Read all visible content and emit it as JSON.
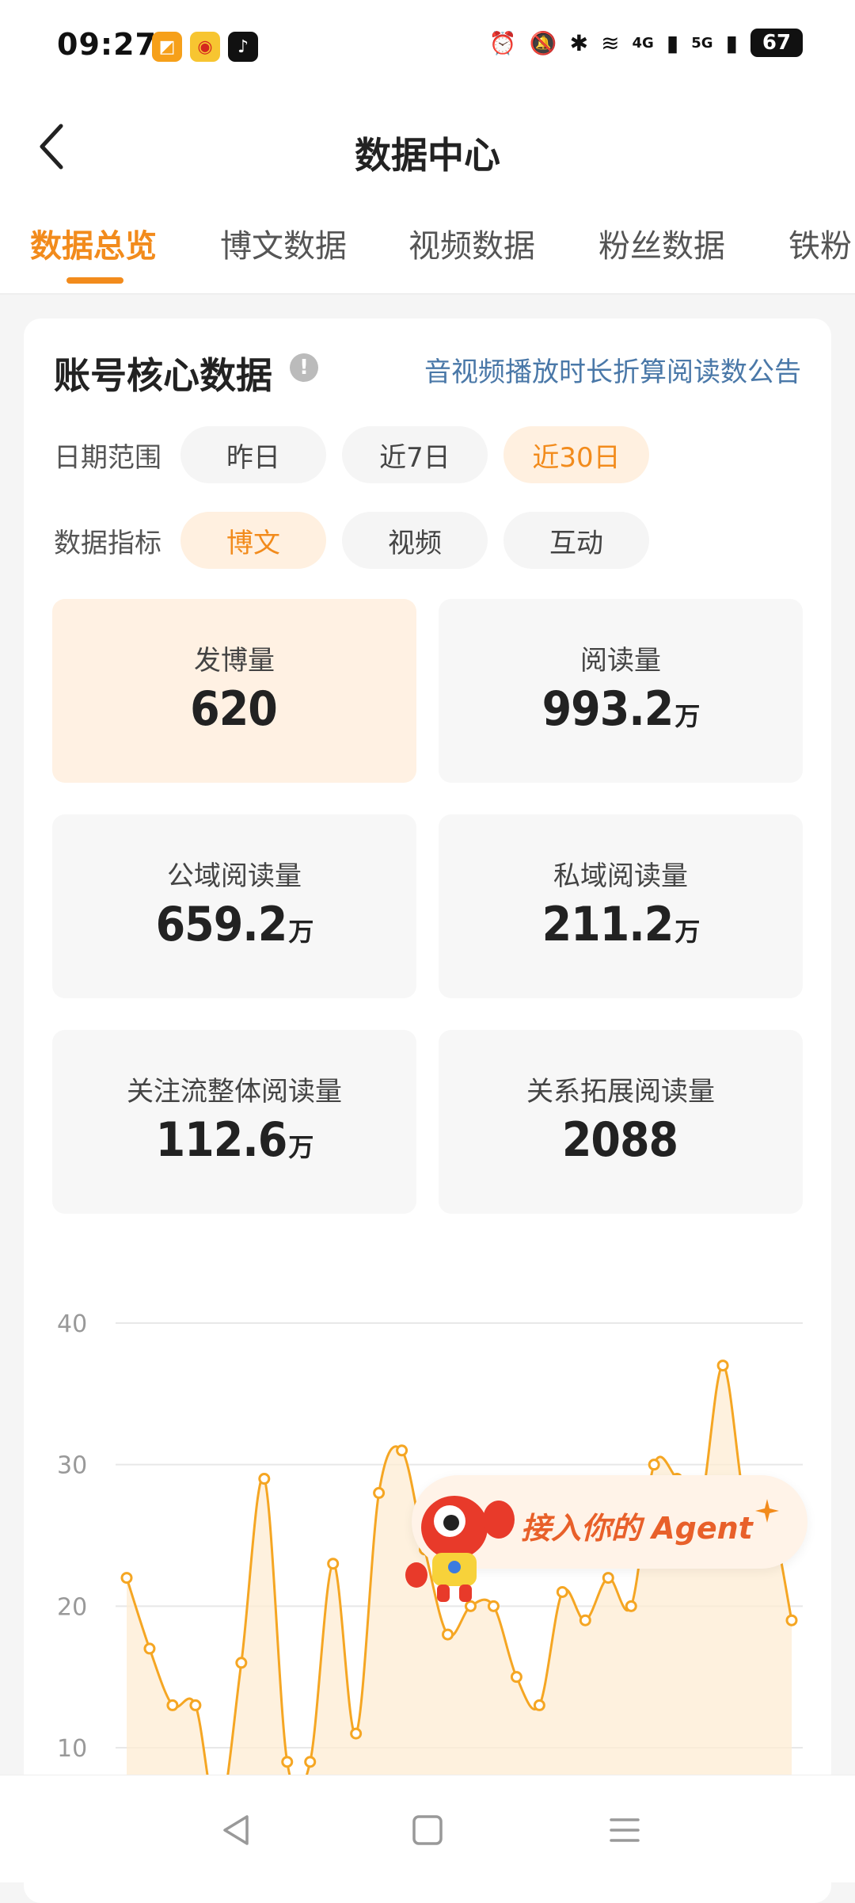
{
  "status": {
    "time": "09:27",
    "battery": "67",
    "signal_4g": "4G",
    "signal_5g": "5G"
  },
  "header": {
    "title": "数据中心"
  },
  "tabs": [
    "数据总览",
    "博文数据",
    "视频数据",
    "粉丝数据",
    "铁粉"
  ],
  "card": {
    "title": "账号核心数据",
    "notice": "音视频播放时长折算阅读数公告",
    "date_label": "日期范围",
    "date_options": [
      "昨日",
      "近7日",
      "近30日"
    ],
    "date_selected": "近30日",
    "metric_label": "数据指标",
    "metric_options": [
      "博文",
      "视频",
      "互动"
    ],
    "metric_selected": "博文"
  },
  "metrics": [
    {
      "label": "发博量",
      "value": "620",
      "unit": ""
    },
    {
      "label": "阅读量",
      "value": "993.2",
      "unit": "万"
    },
    {
      "label": "公域阅读量",
      "value": "659.2",
      "unit": "万"
    },
    {
      "label": "私域阅读量",
      "value": "211.2",
      "unit": "万"
    },
    {
      "label": "关注流整体阅读量",
      "value": "112.6",
      "unit": "万"
    },
    {
      "label": "关系拓展阅读量",
      "value": "2088",
      "unit": ""
    }
  ],
  "agent_banner": {
    "text": "接入你的 Agent"
  },
  "colors": {
    "accent": "#f28b1c",
    "link": "#4a78a8",
    "line": "#f5a623"
  },
  "chart_data": {
    "type": "line",
    "ylim": [
      0,
      40
    ],
    "yticks": [
      "40",
      "30",
      "20",
      "10"
    ],
    "x": [
      1,
      2,
      3,
      4,
      5,
      6,
      7,
      8,
      9,
      10,
      11,
      12,
      13,
      14,
      15,
      16,
      17,
      18,
      19,
      20,
      21,
      22,
      23,
      24,
      25,
      26,
      27,
      28,
      29,
      30
    ],
    "values": [
      22,
      17,
      13,
      13,
      5,
      16,
      29,
      9,
      9,
      23,
      11,
      28,
      31,
      24,
      18,
      20,
      20,
      15,
      13,
      21,
      19,
      22,
      20,
      30,
      29,
      27,
      37,
      27,
      27,
      19
    ]
  }
}
